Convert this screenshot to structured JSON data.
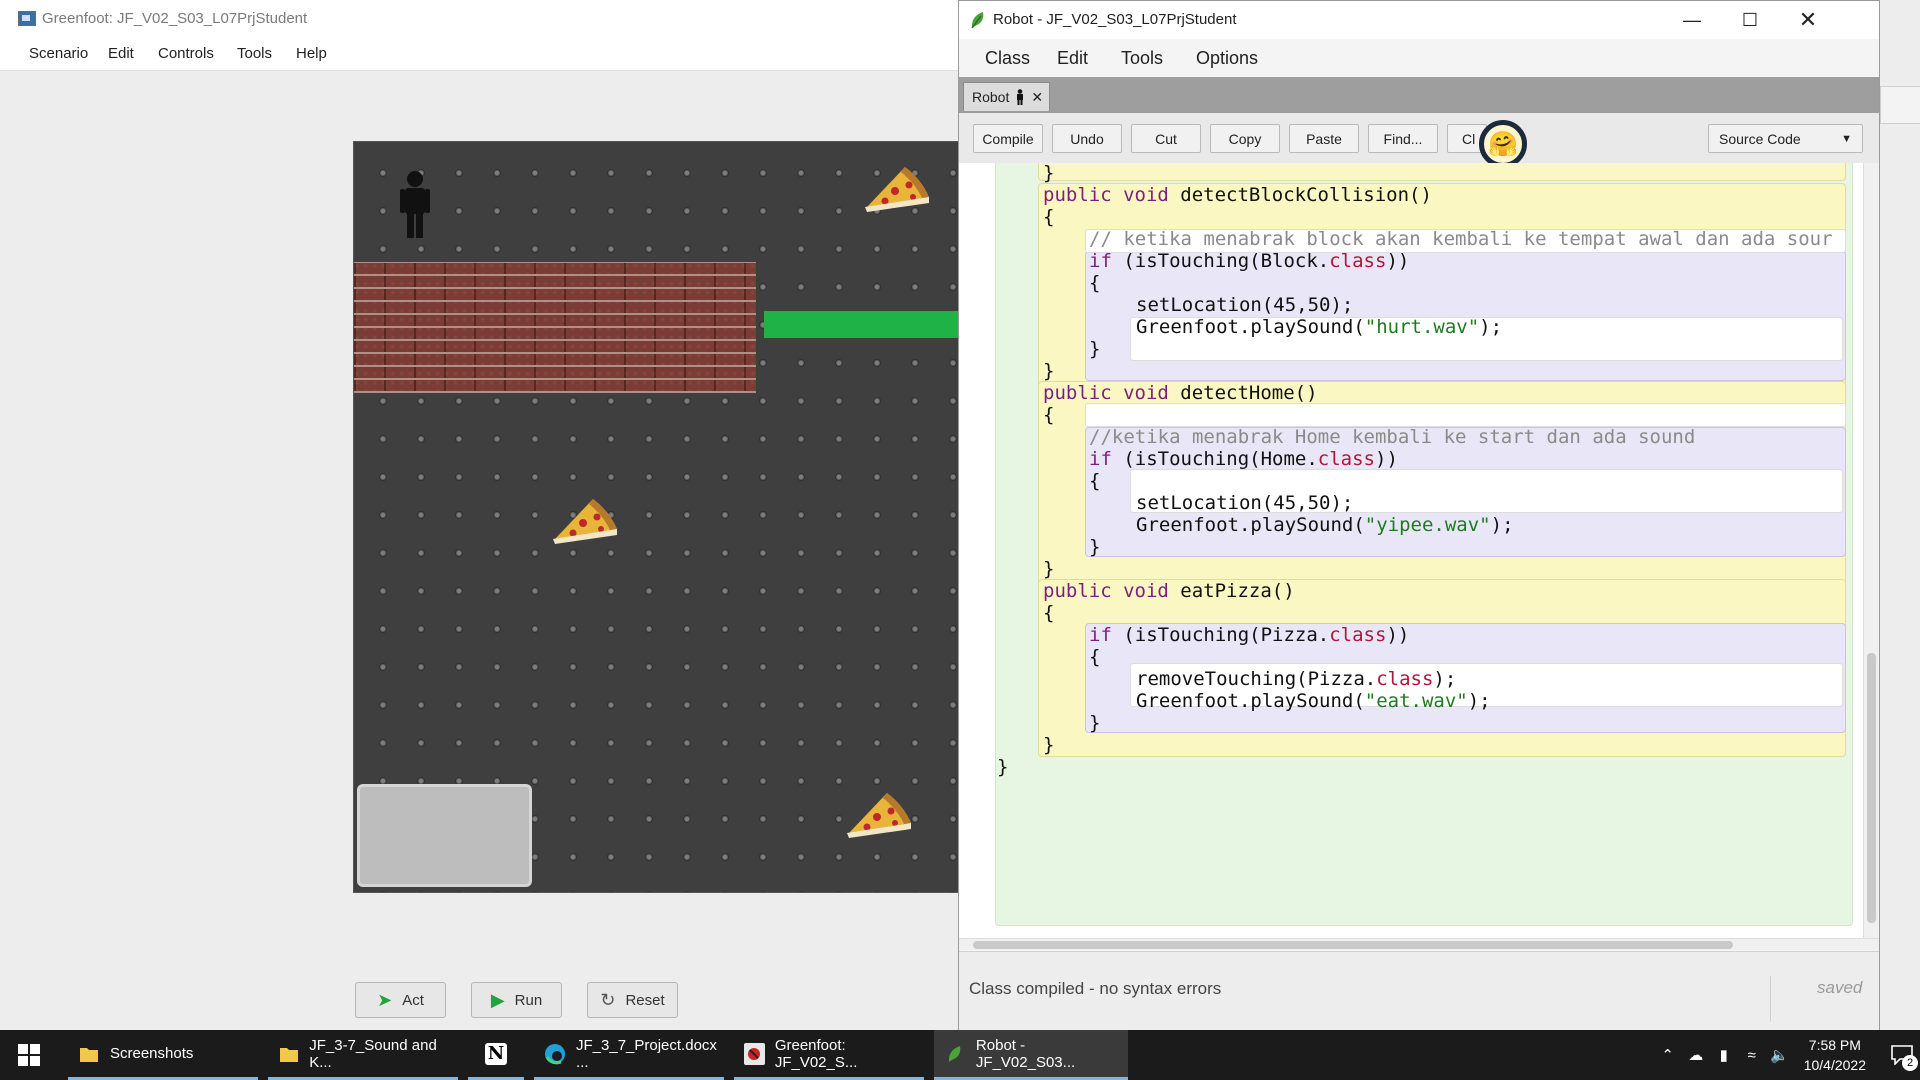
{
  "greenfoot": {
    "title": "Greenfoot: JF_V02_S03_L07PrjStudent",
    "menu": [
      "Scenario",
      "Edit",
      "Controls",
      "Tools",
      "Help"
    ],
    "buttons": {
      "act": "Act",
      "run": "Run",
      "reset": "Reset"
    },
    "world": {
      "actors": [
        "person-icon",
        "pizza-icon",
        "pizza-icon",
        "pizza-icon",
        "brick-wall",
        "green-bar",
        "home-block"
      ],
      "colors": {
        "bar": "#1fb347",
        "home": "#bdbdbd",
        "background": "#3f3f3f"
      }
    }
  },
  "editor": {
    "title": "Robot - JF_V02_S03_L07PrjStudent",
    "menu": [
      "Class",
      "Edit",
      "Tools",
      "Options"
    ],
    "tab_label": "Robot",
    "toolbar": [
      "Compile",
      "Undo",
      "Cut",
      "Copy",
      "Paste",
      "Find...",
      "Cl"
    ],
    "view_select": "Source Code",
    "code": {
      "brace_close_prev": "}",
      "m1_sig_kw": "public void",
      "m1_sig_name": " detectBlockCollision()",
      "m1_comment": "// ketika menabrak block akan kembali ke tempat awal dan ada sour",
      "m1_if_a": "if",
      "m1_if_b": " (isTouching(Block.",
      "m1_if_c": "class",
      "m1_if_d": "))",
      "m1_body_1": "setLocation(45,50);",
      "m1_body_2a": "Greenfoot.playSound(",
      "m1_body_2b": "\"hurt.wav\"",
      "m1_body_2c": ");",
      "m2_sig_kw": "public void",
      "m2_sig_name": " detectHome()",
      "m2_comment": "//ketika menabrak Home kembali ke start dan ada sound",
      "m2_if_a": "if",
      "m2_if_b": " (isTouching(Home.",
      "m2_if_c": "class",
      "m2_if_d": "))",
      "m2_body_1": "setLocation(45,50);",
      "m2_body_2a": "Greenfoot.playSound(",
      "m2_body_2b": "\"yipee.wav\"",
      "m2_body_2c": ");",
      "m3_sig_kw": "public void",
      "m3_sig_name": " eatPizza()",
      "m3_if_a": "if",
      "m3_if_b": " (isTouching(Pizza.",
      "m3_if_c": "class",
      "m3_if_d": "))",
      "m3_body_1a": "removeTouching(Pizza.",
      "m3_body_1b": "class",
      "m3_body_1c": ");",
      "m3_body_2a": "Greenfoot.playSound(",
      "m3_body_2b": "\"eat.wav\"",
      "m3_body_2c": ");",
      "open": "{",
      "close": "}"
    },
    "status": "Class compiled - no syntax errors",
    "saved": "saved"
  },
  "taskbar": {
    "items": [
      {
        "label": "Screenshots",
        "icon": "folder-icon"
      },
      {
        "label": "JF_3-7_Sound and K...",
        "icon": "folder-icon"
      },
      {
        "label": "",
        "icon": "notion-icon"
      },
      {
        "label": "JF_3_7_Project.docx ...",
        "icon": "edge-icon"
      },
      {
        "label": "Greenfoot: JF_V02_S...",
        "icon": "greenfoot-icon"
      },
      {
        "label": "Robot - JF_V02_S03...",
        "icon": "greenfoot-icon"
      }
    ],
    "time": "7:58 PM",
    "date": "10/4/2022",
    "notifications": "2"
  }
}
